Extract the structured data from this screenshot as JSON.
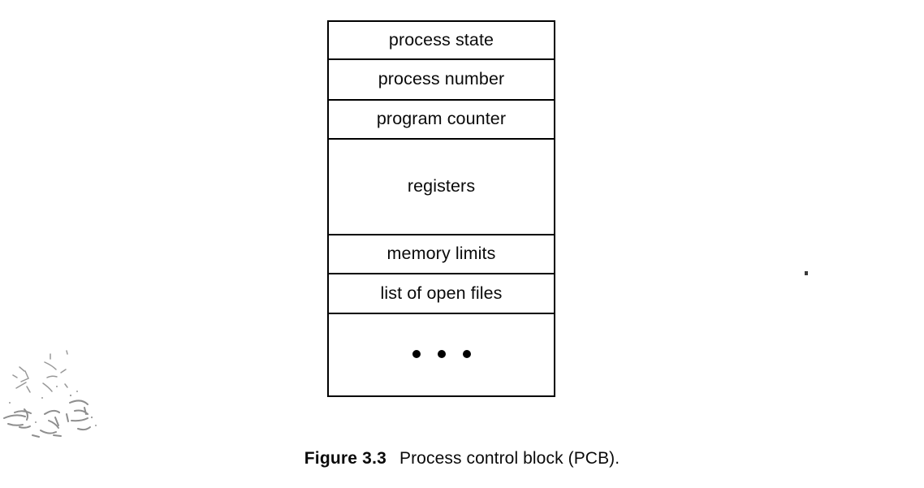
{
  "figure": {
    "caption_number": "Figure 3.3",
    "caption_text": "Process control block (PCB).",
    "diagram_title": "Process control block (PCB)"
  },
  "pcb": {
    "fields": [
      {
        "label": "process state",
        "size": "normal"
      },
      {
        "label": "process number",
        "size": "normal"
      },
      {
        "label": "program counter",
        "size": "normal"
      },
      {
        "label": "registers",
        "size": "tall"
      },
      {
        "label": "memory limits",
        "size": "normal"
      },
      {
        "label": "list of open files",
        "size": "normal"
      },
      {
        "label": "",
        "size": "tall"
      }
    ],
    "ellipsis_dot_count": 3
  },
  "colors": {
    "ink": "#000000",
    "text": "#0a0a0a",
    "background": "#ffffff",
    "artifact": "#5a5a5a"
  }
}
